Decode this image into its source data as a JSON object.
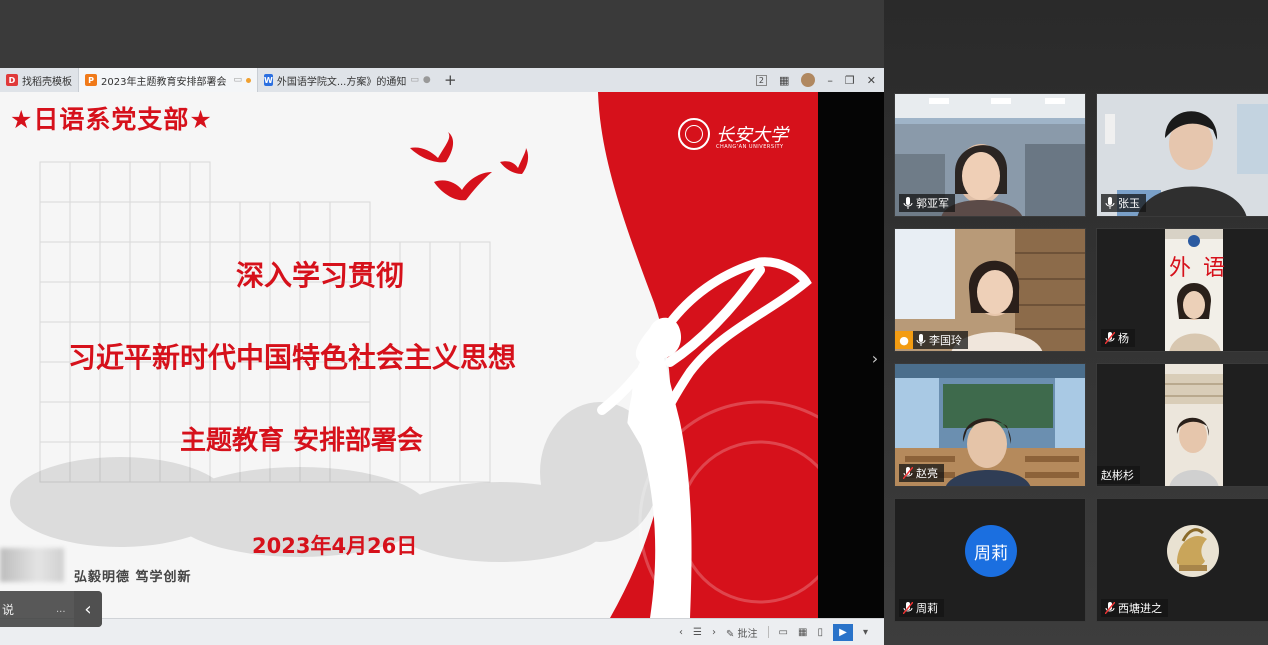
{
  "browser": {
    "tabs": [
      {
        "label": "找稻壳模板",
        "icon_color": "#e03a3a",
        "icon_glyph": "D"
      },
      {
        "label": "2023年主题教育安排部署会",
        "icon_color": "#f07a1a",
        "icon_glyph": "P"
      },
      {
        "label": "外国语学院文...方案》的通知",
        "icon_color": "#2b6fe0",
        "icon_glyph": "W"
      }
    ],
    "new_tab": "+",
    "badge": "2"
  },
  "slide": {
    "branch_title": "★日语系党支部★",
    "title_line_1": "深入学习贯彻",
    "title_line_2": "习近平新时代中国特色社会主义思想",
    "title_line_3": "主题教育 安排部署会",
    "date": "2023年4月26日",
    "motto": "弘毅明德  笃学创新",
    "university_name": "长安大学",
    "university_sub": "CHANG'AN UNIVERSITY",
    "accent_color": "#d6111b"
  },
  "statusbar": {
    "annotate_label": "批注"
  },
  "overlay": {
    "text": "说",
    "dots": "...",
    "collapse_icon": "‹"
  },
  "panel_toggle": "›",
  "participants": [
    {
      "name": "郭亚军",
      "mic": "on"
    },
    {
      "name": "张玉",
      "mic": "on"
    },
    {
      "name": "李国玲",
      "mic": "on"
    },
    {
      "name": "杨",
      "mic": "off"
    },
    {
      "name": "赵亮",
      "mic": "off"
    },
    {
      "name": "赵彬杉",
      "mic": "none"
    },
    {
      "name": "周莉",
      "mic": "off",
      "avatar_text": "周莉",
      "avatar_color": "#1b6fe0"
    },
    {
      "name": "西塘进之",
      "mic": "off"
    }
  ]
}
